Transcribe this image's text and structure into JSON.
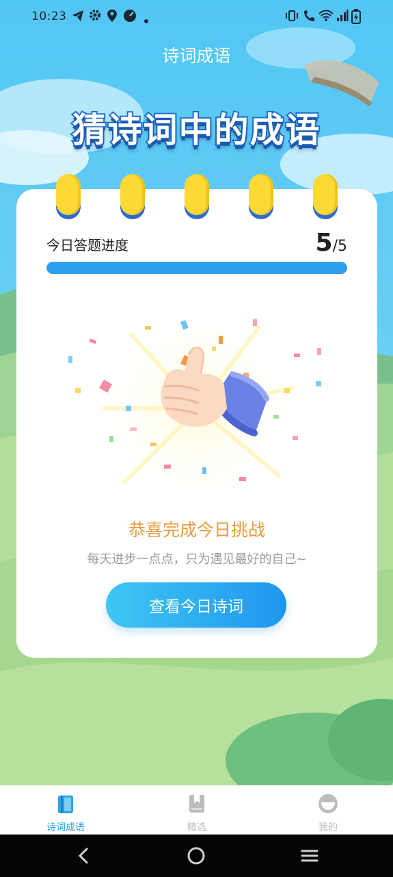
{
  "status_bar": {
    "time": "10:23",
    "left_icons": [
      "telegram-icon",
      "gear-icon",
      "location-icon",
      "speedometer-icon",
      "dot-icon"
    ],
    "right_icons": [
      "vibrate-icon",
      "wifi-calling-icon",
      "wifi-icon",
      "signal-icon",
      "battery-charging-icon"
    ]
  },
  "header": {
    "title": "诗词成语"
  },
  "banner": {
    "text": "猜诗词中的成语"
  },
  "progress": {
    "label": "今日答题进度",
    "current": "5",
    "total": "/5",
    "fraction": 1.0
  },
  "illustration": {
    "name": "thumbs-up-confetti"
  },
  "result": {
    "title": "恭喜完成今日挑战",
    "subtitle": "每天进步一点点，只为遇见最好的自己~",
    "button_label": "查看今日诗词"
  },
  "tabbar": {
    "items": [
      {
        "label": "诗词成语",
        "icon": "book-icon",
        "active": true
      },
      {
        "label": "精选",
        "icon": "bookmark-icon",
        "active": false
      },
      {
        "label": "我的",
        "icon": "profile-icon",
        "active": false
      }
    ]
  },
  "colors": {
    "sky": "#58c9f3",
    "accent_blue": "#2f9ff0",
    "banner_blue": "#1f6fd0",
    "ring_yellow": "#fdd935",
    "congrats_orange": "#ea9a3a",
    "tab_active": "#2fa2e8",
    "tab_inactive": "#bdbdbd"
  },
  "nav_bar": {
    "buttons": [
      "back-icon",
      "home-icon",
      "recents-icon"
    ]
  }
}
